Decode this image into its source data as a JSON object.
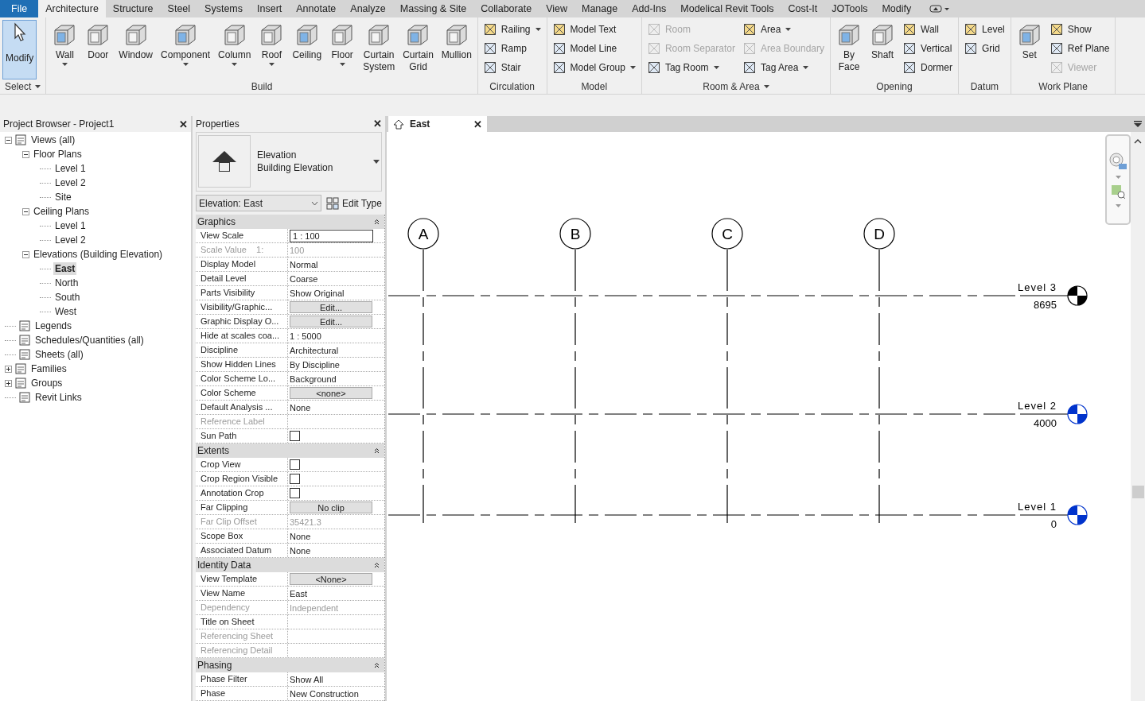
{
  "tabs": [
    {
      "label": "File",
      "kind": "file",
      "selected": false
    },
    {
      "label": "Architecture",
      "kind": "tab",
      "selected": true
    },
    {
      "label": "Structure",
      "kind": "tab",
      "selected": false
    },
    {
      "label": "Steel",
      "kind": "tab",
      "selected": false
    },
    {
      "label": "Systems",
      "kind": "tab",
      "selected": false
    },
    {
      "label": "Insert",
      "kind": "tab",
      "selected": false
    },
    {
      "label": "Annotate",
      "kind": "tab",
      "selected": false
    },
    {
      "label": "Analyze",
      "kind": "tab",
      "selected": false
    },
    {
      "label": "Massing & Site",
      "kind": "tab",
      "selected": false
    },
    {
      "label": "Collaborate",
      "kind": "tab",
      "selected": false
    },
    {
      "label": "View",
      "kind": "tab",
      "selected": false
    },
    {
      "label": "Manage",
      "kind": "tab",
      "selected": false
    },
    {
      "label": "Add-Ins",
      "kind": "tab",
      "selected": false
    },
    {
      "label": "Modelical Revit Tools",
      "kind": "tab",
      "selected": false
    },
    {
      "label": "Cost-It",
      "kind": "tab",
      "selected": false
    },
    {
      "label": "JOTools",
      "kind": "tab",
      "selected": false
    },
    {
      "label": "Modify",
      "kind": "tab",
      "selected": false
    }
  ],
  "ribbon": [
    {
      "title": "Select",
      "title_dropdown": true,
      "groups": [
        {
          "kind": "large",
          "label": "Modify",
          "dropdown": false,
          "selected": true
        }
      ]
    },
    {
      "title": "Build",
      "title_dropdown": false,
      "groups": [
        {
          "kind": "large",
          "label": "Wall",
          "dropdown": true,
          "selected": false
        },
        {
          "kind": "large",
          "label": "Door",
          "dropdown": false,
          "selected": false
        },
        {
          "kind": "large",
          "label": "Window",
          "dropdown": false,
          "selected": false
        },
        {
          "kind": "large",
          "label": "Component",
          "dropdown": true,
          "selected": false
        },
        {
          "kind": "large",
          "label": "Column",
          "dropdown": true,
          "selected": false
        },
        {
          "kind": "large",
          "label": "Roof",
          "dropdown": true,
          "selected": false
        },
        {
          "kind": "large",
          "label": "Ceiling",
          "dropdown": false,
          "selected": false
        },
        {
          "kind": "large",
          "label": "Floor",
          "dropdown": true,
          "selected": false
        },
        {
          "kind": "large",
          "label": "Curtain System",
          "dropdown": false,
          "selected": false
        },
        {
          "kind": "large",
          "label": "Curtain Grid",
          "dropdown": false,
          "selected": false
        },
        {
          "kind": "large",
          "label": "Mullion",
          "dropdown": false,
          "selected": false
        }
      ]
    },
    {
      "title": "Circulation",
      "title_dropdown": false,
      "groups": [
        {
          "kind": "stack",
          "items": [
            {
              "label": "Railing",
              "dropdown": true,
              "disabled": false
            },
            {
              "label": "Ramp",
              "dropdown": false,
              "disabled": false
            },
            {
              "label": "Stair",
              "dropdown": false,
              "disabled": false
            }
          ]
        }
      ]
    },
    {
      "title": "Model",
      "title_dropdown": false,
      "groups": [
        {
          "kind": "stack",
          "items": [
            {
              "label": "Model Text",
              "dropdown": false,
              "disabled": false
            },
            {
              "label": "Model Line",
              "dropdown": false,
              "disabled": false
            },
            {
              "label": "Model Group",
              "dropdown": true,
              "disabled": false
            }
          ]
        }
      ]
    },
    {
      "title": "Room & Area",
      "title_dropdown": true,
      "groups": [
        {
          "kind": "stack",
          "items": [
            {
              "label": "Room",
              "dropdown": false,
              "disabled": true
            },
            {
              "label": "Room Separator",
              "dropdown": false,
              "disabled": true
            },
            {
              "label": "Tag Room",
              "dropdown": true,
              "disabled": false
            }
          ]
        },
        {
          "kind": "stack",
          "items": [
            {
              "label": "Area",
              "dropdown": true,
              "disabled": false
            },
            {
              "label": "Area Boundary",
              "dropdown": false,
              "disabled": true
            },
            {
              "label": "Tag Area",
              "dropdown": true,
              "disabled": false
            }
          ]
        }
      ]
    },
    {
      "title": "Opening",
      "title_dropdown": false,
      "groups": [
        {
          "kind": "large",
          "label": "By Face",
          "dropdown": false,
          "selected": false
        },
        {
          "kind": "large",
          "label": "Shaft",
          "dropdown": false,
          "selected": false
        },
        {
          "kind": "stack",
          "items": [
            {
              "label": "Wall",
              "dropdown": false,
              "disabled": false
            },
            {
              "label": "Vertical",
              "dropdown": false,
              "disabled": false
            },
            {
              "label": "Dormer",
              "dropdown": false,
              "disabled": false
            }
          ]
        }
      ]
    },
    {
      "title": "Datum",
      "title_dropdown": false,
      "groups": [
        {
          "kind": "stack",
          "items": [
            {
              "label": "Level",
              "dropdown": false,
              "disabled": false
            },
            {
              "label": "Grid",
              "dropdown": false,
              "disabled": false
            }
          ]
        }
      ]
    },
    {
      "title": "Work Plane",
      "title_dropdown": false,
      "groups": [
        {
          "kind": "large",
          "label": "Set",
          "dropdown": false,
          "selected": false
        },
        {
          "kind": "stack",
          "items": [
            {
              "label": "Show",
              "dropdown": false,
              "disabled": false
            },
            {
              "label": "Ref Plane",
              "dropdown": false,
              "disabled": false
            },
            {
              "label": "Viewer",
              "dropdown": false,
              "disabled": true
            }
          ]
        }
      ]
    }
  ],
  "project_browser": {
    "title": "Project Browser - Project1",
    "close": "✕",
    "tree": [
      {
        "label": "Views (all)",
        "expanded": true,
        "selected": false,
        "children": [
          {
            "label": "Floor Plans",
            "expanded": true,
            "selected": false,
            "children": [
              {
                "label": "Level 1",
                "selected": false
              },
              {
                "label": "Level 2",
                "selected": false
              },
              {
                "label": "Site",
                "selected": false
              }
            ]
          },
          {
            "label": "Ceiling Plans",
            "expanded": true,
            "selected": false,
            "children": [
              {
                "label": "Level 1",
                "selected": false
              },
              {
                "label": "Level 2",
                "selected": false
              }
            ]
          },
          {
            "label": "Elevations (Building Elevation)",
            "expanded": true,
            "selected": false,
            "children": [
              {
                "label": "East",
                "selected": true
              },
              {
                "label": "North",
                "selected": false
              },
              {
                "label": "South",
                "selected": false
              },
              {
                "label": "West",
                "selected": false
              }
            ]
          }
        ]
      },
      {
        "label": "Legends",
        "selected": false
      },
      {
        "label": "Schedules/Quantities (all)",
        "selected": false
      },
      {
        "label": "Sheets (all)",
        "selected": false
      },
      {
        "label": "Families",
        "expanded": false,
        "selected": false
      },
      {
        "label": "Groups",
        "expanded": false,
        "selected": false
      },
      {
        "label": "Revit Links",
        "selected": false
      }
    ]
  },
  "properties": {
    "title": "Properties",
    "close": "✕",
    "type_name": "Elevation",
    "type_subname": "Building Elevation",
    "instance_selector": "Elevation: East",
    "edit_type": "Edit Type",
    "sections": [
      {
        "title": "Graphics",
        "rows": [
          {
            "label": "View Scale",
            "value": "1 : 100",
            "kind": "input",
            "disabled": false
          },
          {
            "label": "Scale Value    1:",
            "value": "100",
            "kind": "text",
            "disabled": true
          },
          {
            "label": "Display Model",
            "value": "Normal",
            "kind": "text",
            "disabled": false
          },
          {
            "label": "Detail Level",
            "value": "Coarse",
            "kind": "text",
            "disabled": false
          },
          {
            "label": "Parts Visibility",
            "value": "Show Original",
            "kind": "text",
            "disabled": false
          },
          {
            "label": "Visibility/Graphic...",
            "value": "Edit...",
            "kind": "button",
            "disabled": false
          },
          {
            "label": "Graphic Display O...",
            "value": "Edit...",
            "kind": "button",
            "disabled": false
          },
          {
            "label": "Hide at scales coa...",
            "value": "1 : 5000",
            "kind": "text",
            "disabled": false
          },
          {
            "label": "Discipline",
            "value": "Architectural",
            "kind": "text",
            "disabled": false
          },
          {
            "label": "Show Hidden Lines",
            "value": "By Discipline",
            "kind": "text",
            "disabled": false
          },
          {
            "label": "Color Scheme Lo...",
            "value": "Background",
            "kind": "text",
            "disabled": false
          },
          {
            "label": "Color Scheme",
            "value": "<none>",
            "kind": "button",
            "disabled": false
          },
          {
            "label": "Default Analysis ...",
            "value": "None",
            "kind": "text",
            "disabled": false
          },
          {
            "label": "Reference Label",
            "kind": "text",
            "disabled": true
          },
          {
            "label": "Sun Path",
            "kind": "checkbox",
            "checked": false,
            "disabled": false
          }
        ]
      },
      {
        "title": "Extents",
        "rows": [
          {
            "label": "Crop View",
            "kind": "checkbox",
            "checked": false,
            "disabled": false
          },
          {
            "label": "Crop Region Visible",
            "kind": "checkbox",
            "checked": false,
            "disabled": false
          },
          {
            "label": "Annotation Crop",
            "kind": "checkbox",
            "checked": false,
            "disabled": false
          },
          {
            "label": "Far Clipping",
            "value": "No clip",
            "kind": "button",
            "disabled": false
          },
          {
            "label": "Far Clip Offset",
            "value": "35421.3",
            "kind": "text",
            "disabled": true
          },
          {
            "label": "Scope Box",
            "value": "None",
            "kind": "text",
            "disabled": false
          },
          {
            "label": "Associated Datum",
            "value": "None",
            "kind": "text",
            "disabled": false
          }
        ]
      },
      {
        "title": "Identity Data",
        "rows": [
          {
            "label": "View Template",
            "value": "<None>",
            "kind": "button",
            "disabled": false
          },
          {
            "label": "View Name",
            "value": "East",
            "kind": "text",
            "disabled": false
          },
          {
            "label": "Dependency",
            "value": "Independent",
            "kind": "text",
            "disabled": true
          },
          {
            "label": "Title on Sheet",
            "kind": "text",
            "disabled": false
          },
          {
            "label": "Referencing Sheet",
            "kind": "text",
            "disabled": true
          },
          {
            "label": "Referencing Detail",
            "kind": "text",
            "disabled": true
          }
        ]
      },
      {
        "title": "Phasing",
        "rows": [
          {
            "label": "Phase Filter",
            "value": "Show All",
            "kind": "text",
            "disabled": false
          },
          {
            "label": "Phase",
            "value": "New Construction",
            "kind": "text",
            "disabled": false
          }
        ]
      }
    ]
  },
  "view": {
    "tab": "East",
    "close": "✕",
    "grids": [
      {
        "label": "A"
      },
      {
        "label": "B"
      },
      {
        "label": "C"
      },
      {
        "label": "D"
      }
    ],
    "levels": [
      {
        "name": "Level 3",
        "elevation": "8695",
        "color": "#000000"
      },
      {
        "name": "Level 2",
        "elevation": "4000",
        "color": "#0033cc"
      },
      {
        "name": "Level 1",
        "elevation": "0",
        "color": "#0033cc"
      }
    ]
  }
}
